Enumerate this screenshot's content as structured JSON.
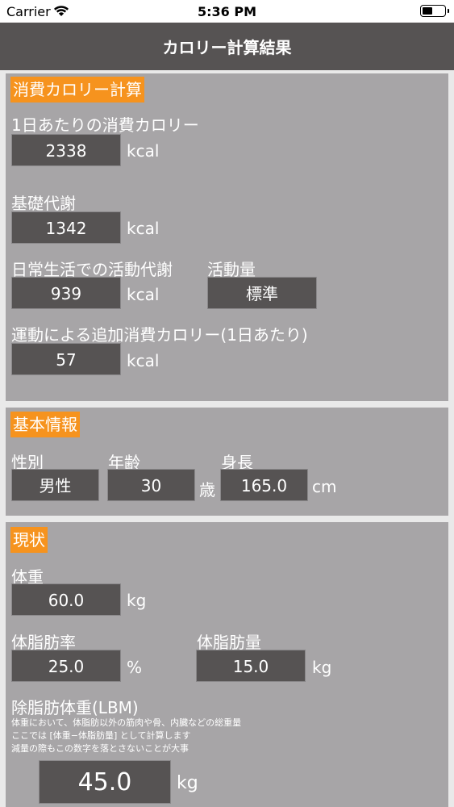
{
  "status_bar": {
    "carrier": "Carrier",
    "time": "5:36 PM"
  },
  "nav": {
    "title": "カロリー計算結果"
  },
  "consumption": {
    "section_title": "消費カロリー計算",
    "daily_label": "1日あたりの消費カロリー",
    "daily_value": "2338",
    "daily_unit": "kcal",
    "bmr_label": "基礎代謝",
    "bmr_value": "1342",
    "bmr_unit": "kcal",
    "activity_label": "日常生活での活動代謝",
    "activity_value": "939",
    "activity_unit": "kcal",
    "activity_level_label": "活動量",
    "activity_level_value": "標準",
    "exercise_label": "運動による追加消費カロリー(1日あたり)",
    "exercise_value": "57",
    "exercise_unit": "kcal"
  },
  "basic_info": {
    "section_title": "基本情報",
    "gender_label": "性別",
    "gender_value": "男性",
    "age_label": "年齢",
    "age_value": "30",
    "age_unit": "歳",
    "height_label": "身長",
    "height_value": "165.0",
    "height_unit": "cm"
  },
  "current": {
    "section_title": "現状",
    "weight_label": "体重",
    "weight_value": "60.0",
    "weight_unit": "kg",
    "bodyfat_rate_label": "体脂肪率",
    "bodyfat_rate_value": "25.0",
    "bodyfat_rate_unit": "%",
    "bodyfat_mass_label": "体脂肪量",
    "bodyfat_mass_value": "15.0",
    "bodyfat_mass_unit": "kg",
    "lbm_label": "除脂肪体重(LBM)",
    "lbm_note_1": "体重において、体脂肪以外の筋肉や骨、内臓などの総重量",
    "lbm_note_2": "ここでは [体重−体脂肪量] として計算します",
    "lbm_note_3": "減量の際もこの数字を落とさないことが大事",
    "lbm_value": "45.0",
    "lbm_unit": "kg"
  }
}
